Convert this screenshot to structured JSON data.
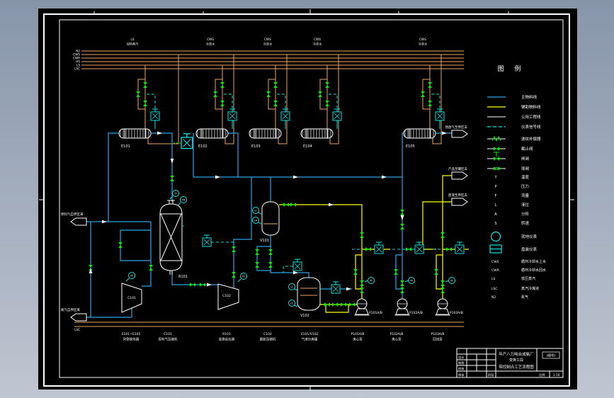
{
  "colors": {
    "window_bg": "#9aa7b8",
    "canvas": "#000000",
    "frame": "#ffffff",
    "main_line": "#2ba7e8",
    "aux_line": "#ffff00",
    "utility_line": "#eda55f",
    "signal_line": "#00e5e5",
    "valve": "#00f000"
  },
  "codes": {
    "rack": [
      "N2",
      "CWS",
      "CWR",
      "HS",
      "LS",
      "LSC"
    ],
    "bottom": [
      "LS",
      "LSC"
    ]
  },
  "top_labels": [
    {
      "l1": "LS",
      "l2": "加热蒸汽"
    },
    {
      "l1": "CWS",
      "l2": "冷却水"
    },
    {
      "l1": "CWS",
      "l2": "冷却水"
    },
    {
      "l1": "CWS",
      "l2": "冷却水"
    },
    {
      "l1": "CWS",
      "l2": "冷却水"
    }
  ],
  "exchangers": [
    "E101",
    "E102",
    "E103",
    "E104",
    "E105"
  ],
  "tags": {
    "reactor": "R101",
    "comp1": "C101",
    "comp2": "C102",
    "drum1": "V101",
    "drum2": "V102",
    "pump1": "P101A/B",
    "pump2": "P102A/B",
    "pump3": "P103A/B"
  },
  "flags": {
    "left1": "原料气自界区来",
    "left2": "氮气自界区来",
    "right1": "弛放气至界区去",
    "right2": "产品至罐区去",
    "right3": "废液至界区去"
  },
  "bubbles": [
    "TI",
    "TR",
    "LI",
    "LA",
    "PI",
    "PI",
    "LI",
    "LC",
    "PI",
    "PI",
    "PI"
  ],
  "legend": {
    "title": "图  例",
    "lines": [
      {
        "label": "主物料线"
      },
      {
        "label": "辅助物料线"
      },
      {
        "label": "公用工程线"
      },
      {
        "label": "仪表信号线"
      },
      {
        "label": "波纹补偿器"
      },
      {
        "label": "截止阀"
      },
      {
        "label": "闸阀"
      },
      {
        "label": "球阀"
      }
    ],
    "letters": [
      {
        "k": "T",
        "v": "温度"
      },
      {
        "k": "P",
        "v": "压力"
      },
      {
        "k": "F",
        "v": "流量"
      },
      {
        "k": "L",
        "v": "液位"
      },
      {
        "k": "A",
        "v": "分析"
      },
      {
        "k": "S",
        "v": "转速"
      }
    ],
    "symbols": [
      {
        "label": "就地仪表"
      },
      {
        "label": "盘装仪表"
      }
    ],
    "utility_codes": [
      {
        "k": "CWS",
        "v": "循环冷却水上水"
      },
      {
        "k": "CWR",
        "v": "循环冷却水回水"
      },
      {
        "k": "LS",
        "v": "低压蒸汽"
      },
      {
        "k": "LSC",
        "v": "蒸汽冷凝液"
      },
      {
        "k": "N2",
        "v": "氮气"
      }
    ]
  },
  "bottom_labels": [
    {
      "tag": "E101~E105",
      "name": "列管换热器"
    },
    {
      "tag": "C101",
      "name": "原料气压缩机"
    },
    {
      "tag": "R101",
      "name": "变换反应器"
    },
    {
      "tag": "C102",
      "name": "膨胀压缩机"
    },
    {
      "tag": "V101/V102",
      "name": "气液分离罐"
    },
    {
      "tag": "P101A/B",
      "name": "离心泵"
    },
    {
      "tag": "P102A/B",
      "name": "离心泵"
    },
    {
      "tag": "P103A/B",
      "name": "回流泵"
    }
  ],
  "titleblock": {
    "rows": [
      "设计",
      "制图",
      "校核",
      "审核"
    ],
    "stage": "阶段",
    "title1": "年产八万吨合成氨厂",
    "title2": "变换工段",
    "title3": "带控制点工艺流程图",
    "dwg_no": "(图号)",
    "scale_label": "比例",
    "scale": "1:50"
  }
}
